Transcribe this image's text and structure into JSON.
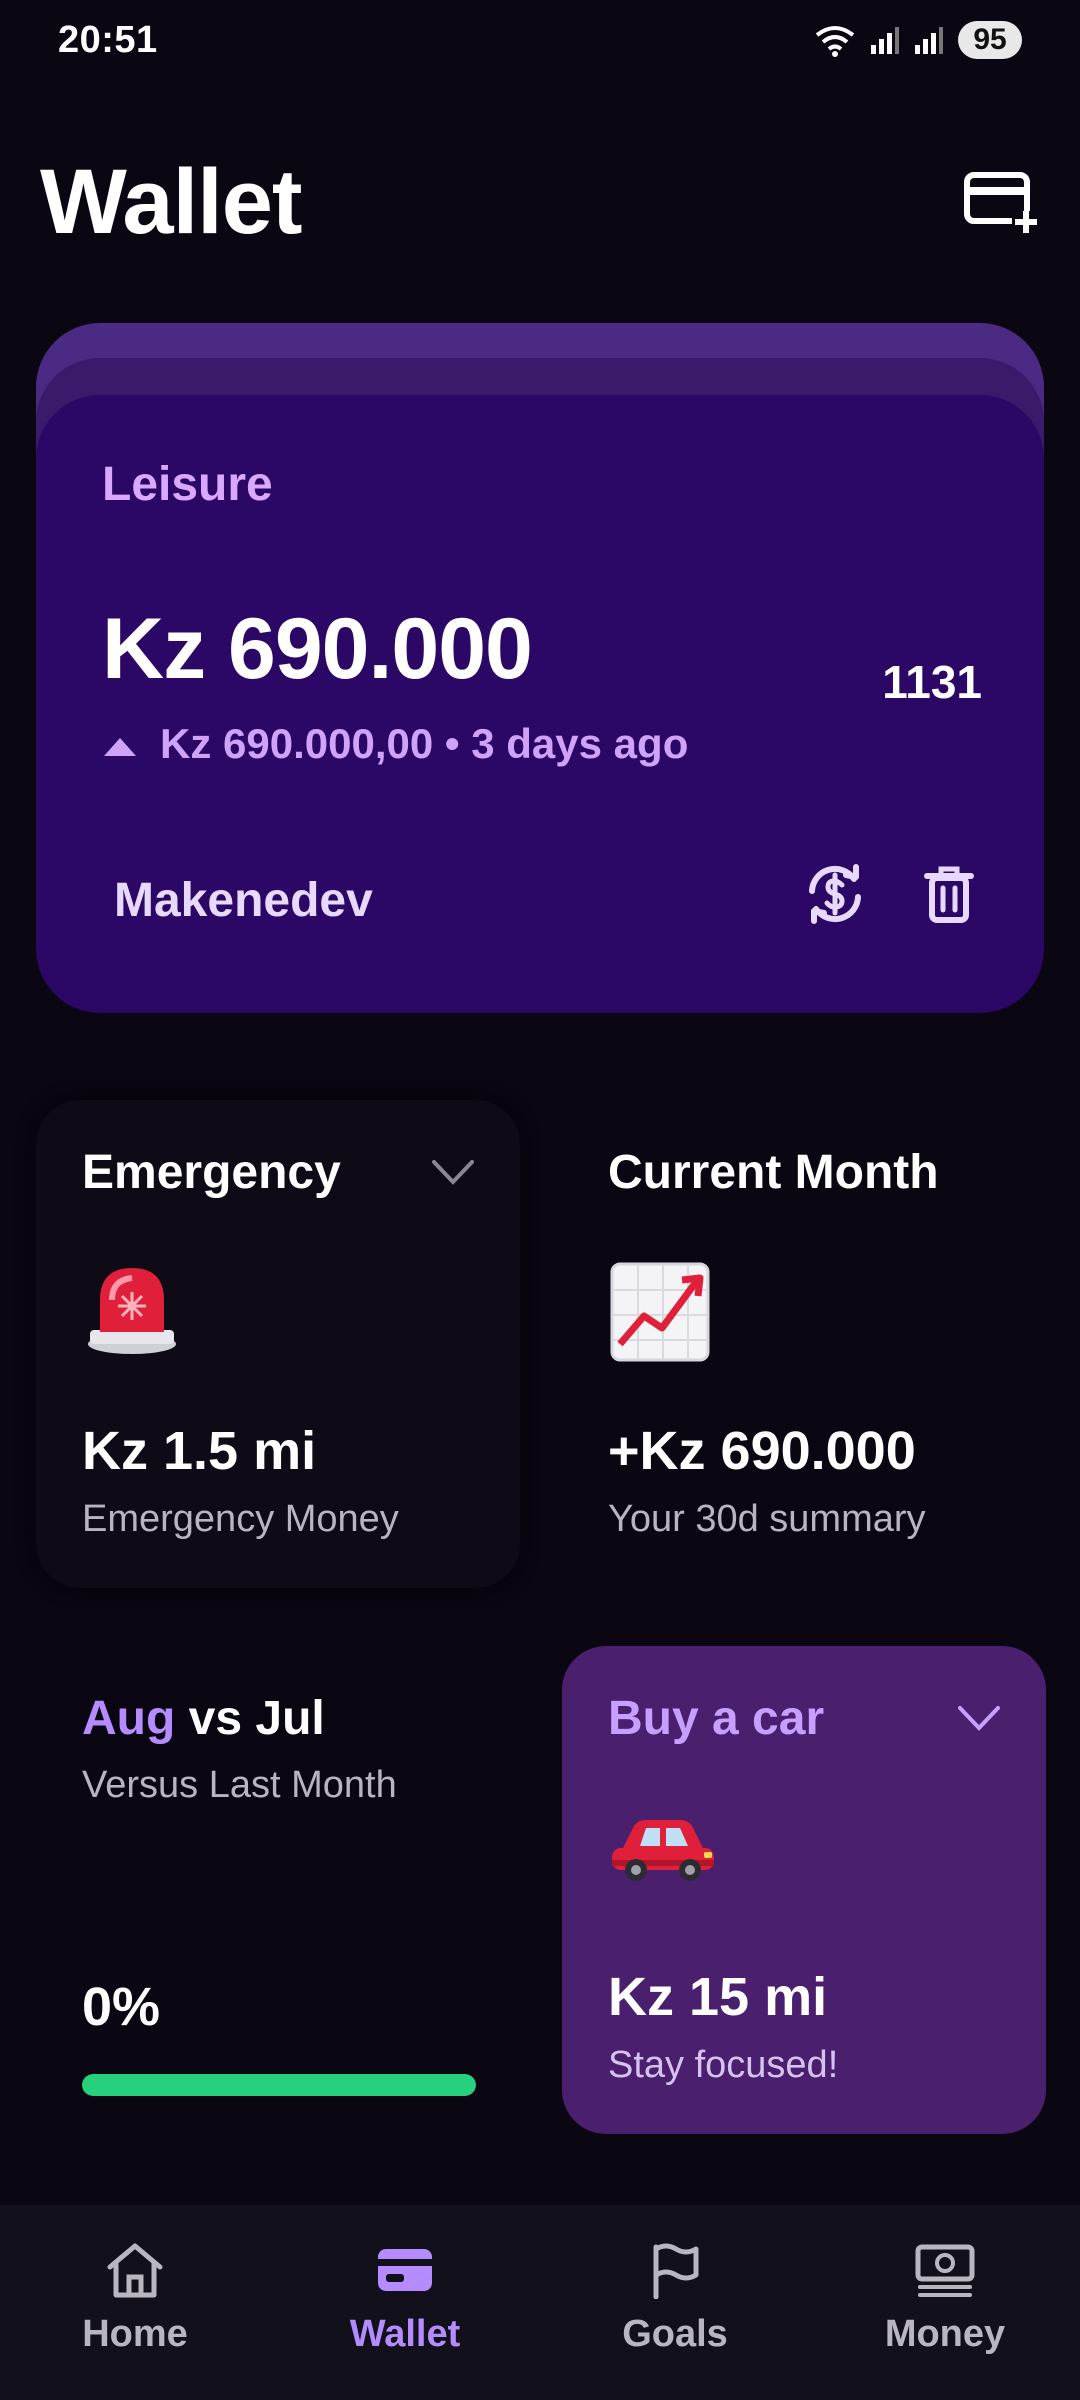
{
  "status": {
    "time": "20:51",
    "battery": "95",
    "icons": [
      "wifi-icon",
      "signal-icon",
      "signal-icon"
    ]
  },
  "header": {
    "title": "Wallet",
    "action_icon": "add-card-icon"
  },
  "wallet_card": {
    "name": "Leisure",
    "amount": "Kz 690.000",
    "number": "1131",
    "change": "Kz 690.000,00 • 3 days ago",
    "holder": "Makenedev",
    "colors": {
      "card": "#2b0866",
      "accent": "#d9a9ff"
    }
  },
  "tiles": {
    "emergency": {
      "title": "Emergency",
      "emoji": "🚨",
      "value": "Kz 1.5 mi",
      "subtitle": "Emergency Money"
    },
    "current_month": {
      "title": "Current Month",
      "emoji": "📈",
      "value": "+Kz 690.000",
      "subtitle": "Your 30d summary"
    },
    "versus": {
      "month_a": "Aug",
      "vs_text": "vs Jul",
      "subtitle": "Versus Last Month",
      "percent": "0%",
      "progress": 1.0,
      "bar_color": "#26d07c"
    },
    "goal": {
      "title": "Buy a car",
      "emoji": "🚗",
      "value": "Kz 15 mi",
      "subtitle": "Stay focused!"
    }
  },
  "nav": {
    "items": [
      {
        "label": "Home",
        "icon": "home-icon",
        "active": false
      },
      {
        "label": "Wallet",
        "icon": "wallet-icon",
        "active": true
      },
      {
        "label": "Goals",
        "icon": "flag-icon",
        "active": false
      },
      {
        "label": "Money",
        "icon": "money-icon",
        "active": false
      }
    ]
  }
}
